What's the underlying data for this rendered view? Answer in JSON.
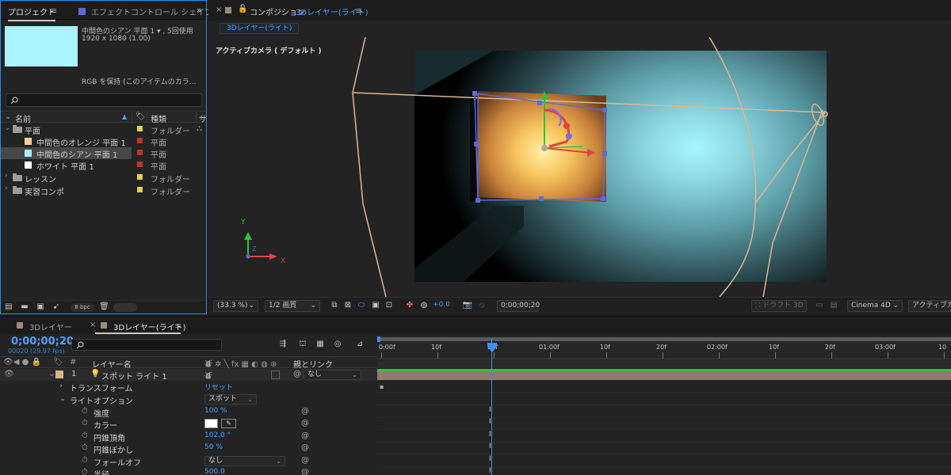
{
  "colors": {
    "accent_blue": "#4aa3ff",
    "tag_yellow": "#e8d04b",
    "tag_red": "#c2312d",
    "swatch_orange": "#f5cf8f",
    "swatch_cyan": "#a9f3ff",
    "swatch_white": "#ffffff",
    "light_tag": "#d8b387",
    "layer_bar": "#8d7c6b",
    "track_green": "#2fc43b"
  },
  "project": {
    "tab_project": "プロジェクト",
    "tab_effects": "エフェクトコントロール シェイプ",
    "item_name": "中間色のシアン 平面 1 ▾ , 5回使用",
    "item_size": "1920 x 1080 (1.00)",
    "item_color_info": "RGB を保持 (このアイテムのカラ...",
    "search_icon": "search-icon",
    "columns": {
      "name": "名前",
      "type": "種類",
      "size": "サ"
    },
    "rows": [
      {
        "kind": "folder",
        "label": "平面",
        "type": "フォルダー",
        "tag": "yellow",
        "expanded": true
      },
      {
        "kind": "solid",
        "label": "中間色のオレンジ 平面 1",
        "type": "平面",
        "tag": "red",
        "swatch": "orange"
      },
      {
        "kind": "solid",
        "label": "中間色のシアン 平面 1",
        "type": "平面",
        "tag": "red",
        "swatch": "cyan",
        "selected": true
      },
      {
        "kind": "solid",
        "label": "ホワイト 平面 1",
        "type": "平面",
        "tag": "red",
        "swatch": "white"
      },
      {
        "kind": "folder",
        "label": "レッスン",
        "type": "フォルダー",
        "tag": "yellow"
      },
      {
        "kind": "folder",
        "label": "実習コンポ",
        "type": "フォルダー",
        "tag": "yellow"
      }
    ],
    "bpc": "8 bpc"
  },
  "composition": {
    "tab_prefix": "コンポジション",
    "tab_name": "3Dレイヤー(ライト)",
    "breadcrumb": "3Dレイヤー(ライト)",
    "camera_label": "アクティブカメラ ( デフォルト )",
    "axis_x": "X",
    "axis_y": "Y",
    "axis_z": "Z",
    "zoom": "(33.3 %)",
    "resolution": "1/2 画質",
    "exposure": "+0.0",
    "timecode": "0;00;00;20",
    "draft3d": "ドラフト 3D",
    "renderer": "Cinema 4D",
    "view": "アクティブカメ"
  },
  "timeline": {
    "tab1": "3Dレイヤー",
    "tab2": "3Dレイヤー(ライト)",
    "timecode": "0;00;00;20",
    "fps": "00020 (29.97 fps)",
    "header_layer": "レイヤー名",
    "header_num": "#",
    "header_parent": "親とリンク",
    "layer_number": "1",
    "layer_name": "スポット ライト 1",
    "parent_value": "なし",
    "transform_label": "トランスフォーム",
    "reset_label": "リセット",
    "light_options_label": "ライトオプション",
    "light_type": "スポット",
    "props": [
      {
        "label": "強度",
        "value": "100 %"
      },
      {
        "label": "カラー",
        "value": ""
      },
      {
        "label": "円錐頂角",
        "value": "102.0 °"
      },
      {
        "label": "円錐ぼかし",
        "value": "50 %"
      },
      {
        "label": "フォールオフ",
        "value": "なし"
      },
      {
        "label": "半径",
        "value": "500.0"
      }
    ],
    "ruler_ticks": [
      "0:00f",
      "10f",
      "20f",
      "01:00f",
      "10f",
      "20f",
      "02:00f",
      "10f",
      "20f",
      "03:00f",
      "10"
    ]
  }
}
